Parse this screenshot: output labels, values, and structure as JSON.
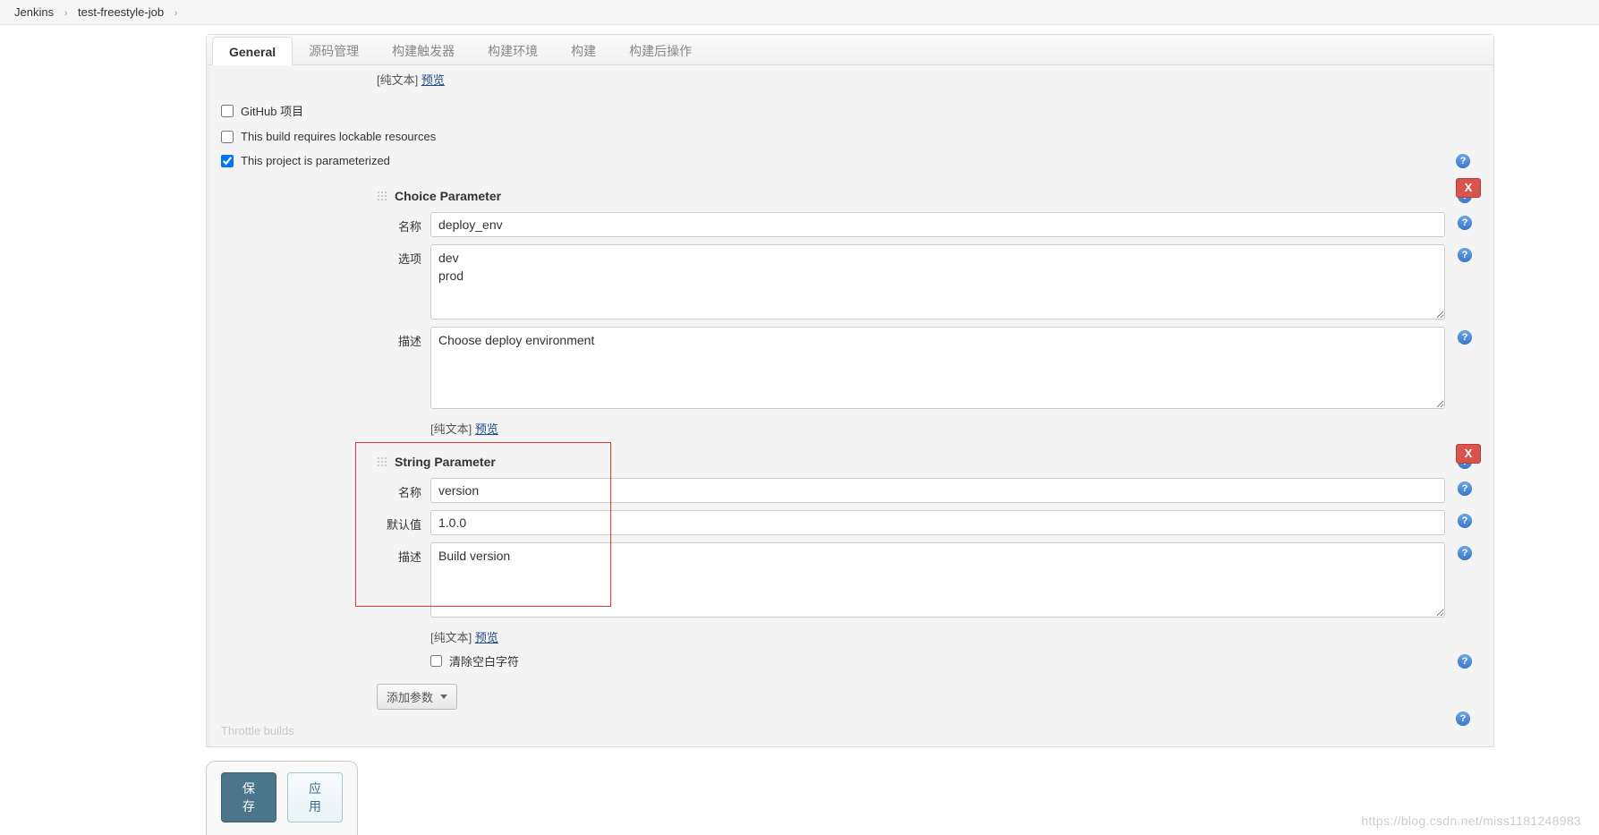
{
  "breadcrumb": {
    "root": "Jenkins",
    "job": "test-freestyle-job"
  },
  "tabs": {
    "general": "General",
    "scm": "源码管理",
    "triggers": "构建触发器",
    "env": "构建环境",
    "build": "构建",
    "postbuild": "构建后操作"
  },
  "top_preview": {
    "plain": "[纯文本]",
    "preview": "预览"
  },
  "checks": {
    "github": "GitHub 项目",
    "lockable": "This build requires lockable resources",
    "parameterized": "This project is parameterized"
  },
  "params": {
    "choice": {
      "title": "Choice Parameter",
      "name_label": "名称",
      "name_value": "deploy_env",
      "options_label": "选项",
      "options_value": "dev\nprod",
      "desc_label": "描述",
      "desc_value": "Choose deploy environment",
      "preview_plain": "[纯文本]",
      "preview_link": "预览",
      "delete": "X"
    },
    "string": {
      "title": "String Parameter",
      "name_label": "名称",
      "name_value": "version",
      "default_label": "默认值",
      "default_value": "1.0.0",
      "desc_label": "描述",
      "desc_value": "Build version",
      "preview_plain": "[纯文本]",
      "preview_link": "预览",
      "trim_label": "清除空白字符",
      "delete": "X"
    }
  },
  "add_param": "添加参数",
  "throttle_hint": "Throttle builds",
  "buttons": {
    "save": "保存",
    "apply": "应用"
  },
  "watermark": "https://blog.csdn.net/miss1181248983"
}
